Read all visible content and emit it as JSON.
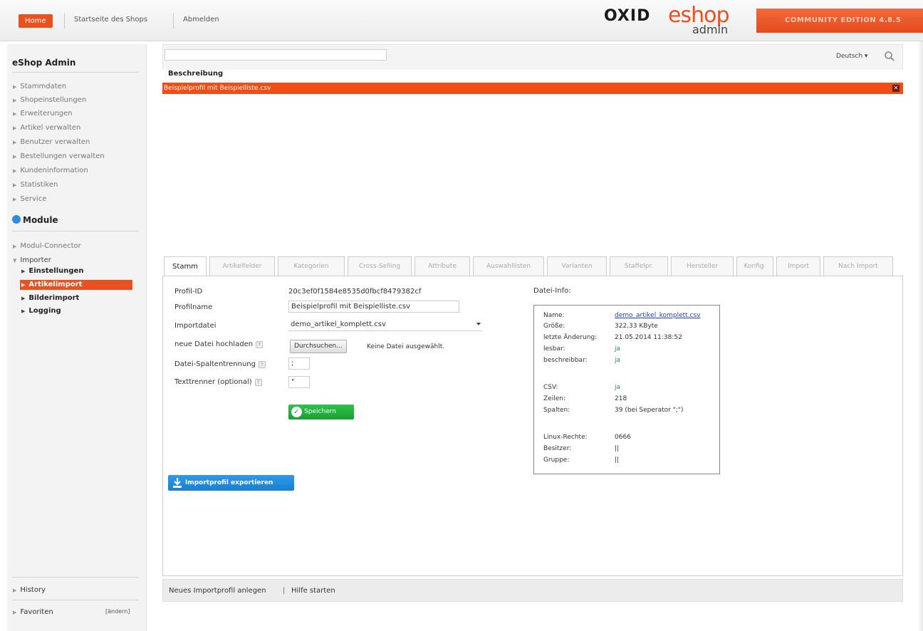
{
  "topnav": {
    "home": "Home",
    "shopstart": "Startseite des Shops",
    "logout": "Abmelden"
  },
  "logo": {
    "oxid": "OXID",
    "eshop": "eshop",
    "admin": "admin"
  },
  "edition": "COMMUNITY EDITION 4.8.5",
  "sidebar": {
    "title": "eShop Admin",
    "items": [
      "Stammdaten",
      "Shopeinstellungen",
      "Erweiterungen",
      "Artikel verwalten",
      "Benutzer verwalten",
      "Bestellungen verwalten",
      "Kundeninformation",
      "Statistiken",
      "Service"
    ],
    "module_heading": "Module",
    "module_items": [
      "Modul-Connector",
      "Importer"
    ],
    "importer_sub": [
      "Einstellungen",
      "Artikelimport",
      "Bilderimport",
      "Logging"
    ],
    "history": "History",
    "favorites": "Favoriten",
    "favorites_edit": "[ändern]"
  },
  "list": {
    "language": "Deutsch",
    "column_header": "Beschreibung",
    "rows": [
      "Beispielprofil mit Beispielliste.csv"
    ]
  },
  "tabs": [
    "Stamm",
    "Artikelfelder",
    "Kategorien",
    "Cross-Selling",
    "Attribute",
    "Auswahllisten",
    "Varianten",
    "Staffelpr.",
    "Hersteller",
    "Konfig.",
    "Import",
    "Nach Import"
  ],
  "form": {
    "profile_id_label": "Profil-ID",
    "profile_id": "20c3ef0f1584e8535d0fbcf8479382cf",
    "profile_name_label": "Profilname",
    "profile_name": "Beispielprofil mit Beispielliste.csv",
    "importfile_label": "Importdatei",
    "importfile": "demo_artikel_komplett.csv",
    "upload_label": "neue Datei hochladen",
    "browse": "Durchsuchen...",
    "no_file": "Keine Datei ausgewählt.",
    "separator_label": "Datei-Spaltentrennung",
    "separator": ";",
    "enclosure_label": "Texttrenner (optional)",
    "enclosure": "\"",
    "help": "?",
    "save": "Speichern",
    "export": "Importprofil exportieren"
  },
  "fileinfo": {
    "title": "Datei-Info:",
    "rows": [
      {
        "k": "Name:",
        "v": "demo_artikel_komplett.csv"
      },
      {
        "k": "Größe:",
        "v": "322,33 KByte"
      },
      {
        "k": "letzte Änderung:",
        "v": "21.05.2014 11:38:52"
      },
      {
        "k": "lesbar:",
        "v": "ja"
      },
      {
        "k": "beschreibbar:",
        "v": "ja"
      },
      {
        "k": "CSV:",
        "v": "ja"
      },
      {
        "k": "Zeilen:",
        "v": "218"
      },
      {
        "k": "Spalten:",
        "v": "39 (bei Seperator \";\")"
      },
      {
        "k": "Linux-Rechte:",
        "v": "0666"
      },
      {
        "k": "Besitzer:",
        "v": "||"
      },
      {
        "k": "Gruppe:",
        "v": "||"
      }
    ]
  },
  "bottom": {
    "new_profile": "Neues Importprofil anlegen",
    "sep": "|",
    "help": "Hilfe starten"
  },
  "colors": {
    "accent": "#e9511f",
    "save": "#1b9f33",
    "export": "#1a7fd1"
  }
}
